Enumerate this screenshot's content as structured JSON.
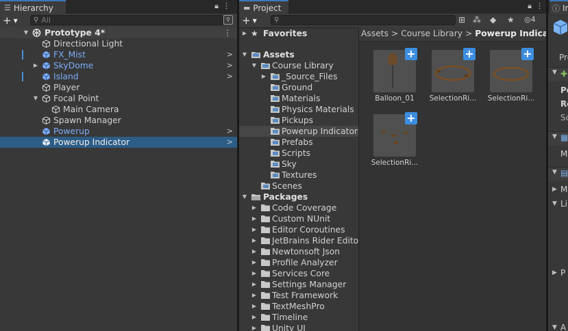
{
  "hierarchy": {
    "tab_label": "Hierarchy",
    "search_placeholder": "All",
    "scene_name": "Prototype 4*",
    "items": [
      {
        "label": "Directional Light"
      },
      {
        "label": "FX_Mist"
      },
      {
        "label": "SkyDome"
      },
      {
        "label": "Island"
      },
      {
        "label": "Player"
      },
      {
        "label": "Focal Point"
      },
      {
        "label": "Main Camera"
      },
      {
        "label": "Spawn Manager"
      },
      {
        "label": "Powerup"
      },
      {
        "label": "Powerup Indicator"
      }
    ]
  },
  "project": {
    "tab_label": "Project",
    "hidden_count": "4",
    "tree": {
      "favorites": "Favorites",
      "assets": "Assets",
      "course_library": "Course Library",
      "course_children": [
        "_Source_Files",
        "Ground",
        "Materials",
        "Physics Materials",
        "Pickups",
        "Powerup Indicators",
        "Prefabs",
        "Scripts",
        "Sky",
        "Textures"
      ],
      "scenes": "Scenes",
      "packages": "Packages",
      "package_children": [
        "Code Coverage",
        "Custom NUnit",
        "Editor Coroutines",
        "JetBrains Rider Editor",
        "Newtonsoft Json",
        "Profile Analyzer",
        "Services Core",
        "Settings Manager",
        "Test Framework",
        "TextMeshPro",
        "Timeline",
        "Unity UI"
      ]
    },
    "breadcrumb": [
      "Assets",
      "Course Library",
      "Powerup Indicators"
    ],
    "breadcrumb_sep": ">",
    "assets": [
      {
        "name": "Balloon_01"
      },
      {
        "name": "SelectionRi..."
      },
      {
        "name": "SelectionRi..."
      },
      {
        "name": "SelectionRi..."
      }
    ]
  },
  "inspector": {
    "tab_label": "In",
    "labels": [
      "Pre",
      "Po",
      "Ro",
      "Sc",
      "M",
      "M",
      "Li",
      "P",
      "A"
    ]
  },
  "colors": {
    "accent": "#3a79bb",
    "selection": "#2c5d87",
    "prefab_blue": "#7cacf8",
    "add_badge": "#3d8ee0"
  }
}
